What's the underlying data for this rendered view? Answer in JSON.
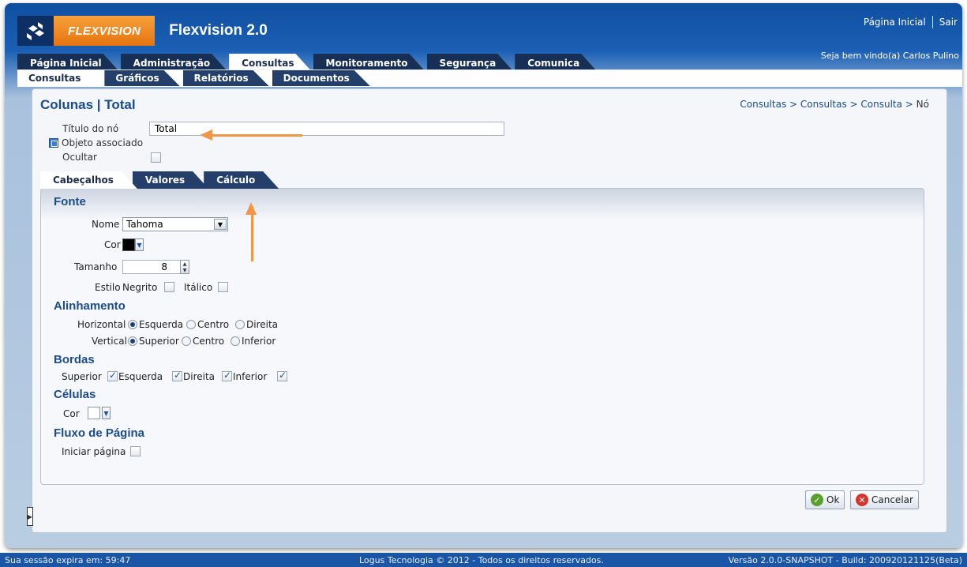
{
  "header": {
    "logo_text": "FLEXVISION",
    "app_title": "Flexvision 2.0",
    "home_link": "Página Inicial",
    "logout_link": "Sair",
    "welcome": "Seja bem vindo(a) Carlos Pulino"
  },
  "main_tabs": [
    {
      "label": "Página Inicial"
    },
    {
      "label": "Administração"
    },
    {
      "label": "Consultas"
    },
    {
      "label": "Monitoramento"
    },
    {
      "label": "Segurança"
    },
    {
      "label": "Comunica"
    }
  ],
  "sub_tabs": [
    {
      "label": "Consultas"
    },
    {
      "label": "Gráficos"
    },
    {
      "label": "Relatórios"
    },
    {
      "label": "Documentos"
    }
  ],
  "page": {
    "title": "Colunas | Total",
    "breadcrumb": "Consultas > Consultas > Consulta > ",
    "breadcrumb_current": "Nó",
    "node_title_label": "Título do nó",
    "node_title_value": "Total",
    "associated_object_label": "Objeto associado",
    "hide_label": "Ocultar"
  },
  "inner_tabs": [
    {
      "label": "Cabeçalhos"
    },
    {
      "label": "Valores"
    },
    {
      "label": "Cálculo"
    }
  ],
  "font": {
    "section": "Fonte",
    "name_label": "Nome",
    "name_value": "Tahoma",
    "color_label": "Cor",
    "color_value": "#000000",
    "size_label": "Tamanho",
    "size_value": "8",
    "style_label": "Estilo",
    "bold_label": "Negrito",
    "italic_label": "Itálico"
  },
  "alignment": {
    "section": "Alinhamento",
    "horizontal_label": "Horizontal",
    "horizontal_options": [
      "Esquerda",
      "Centro",
      "Direita"
    ],
    "vertical_label": "Vertical",
    "vertical_options": [
      "Superior",
      "Centro",
      "Inferior"
    ]
  },
  "borders": {
    "section": "Bordas",
    "top": "Superior",
    "left": "Esquerda",
    "right": "Direita",
    "bottom": "Inferior"
  },
  "cells": {
    "section": "Células",
    "color_label": "Cor",
    "color_value": "#ffffff"
  },
  "page_flow": {
    "section": "Fluxo de Página",
    "start_page_label": "Iniciar página"
  },
  "actions": {
    "ok": "Ok",
    "cancel": "Cancelar"
  },
  "footer": {
    "session": "Sua sessão expira em: 59:47",
    "copyright": "Logus Tecnologia © 2012 - Todos os direitos reservados.",
    "version": "Versão 2.0.0-SNAPSHOT - Build: 200920121125(Beta)"
  },
  "colors": {
    "accent_orange": "#f0964a",
    "header_blue": "#1b56a6",
    "title_blue": "#1b4c8c"
  }
}
